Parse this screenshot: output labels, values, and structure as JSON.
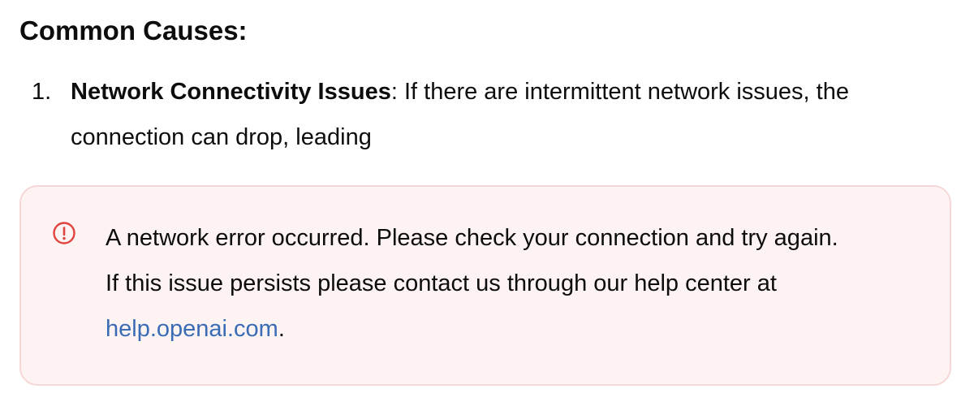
{
  "section": {
    "heading": "Common Causes:"
  },
  "causes": [
    {
      "number": "1.",
      "title": "Network Connectivity Issues",
      "separator": ":",
      "text": " If there are intermittent network issues, the connection can drop, leading"
    }
  ],
  "error": {
    "icon": "info-circle-icon",
    "message_line1": "A network error occurred. Please check your connection and try again.",
    "message_line2": "If this issue persists please contact us through our help center at",
    "link_text": "help.openai.com",
    "trailing": ".",
    "accent_color": "#e0443e",
    "background_color": "#fdf3f2",
    "border_color": "#f7d7d5",
    "link_color": "#3a6bb5"
  }
}
